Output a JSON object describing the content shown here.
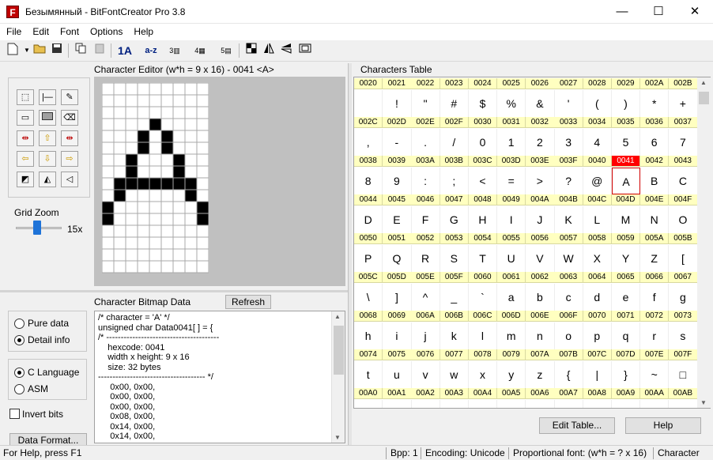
{
  "window": {
    "title": "Безымянный - BitFontCreator Pro 3.8",
    "app_icon_letter": "F",
    "minimize": "—",
    "maximize": "☐",
    "close": "✕"
  },
  "menu": [
    "File",
    "Edit",
    "Font",
    "Options",
    "Help"
  ],
  "toolbar": {
    "btn1": "1A",
    "btn2": "a-z",
    "btn3": "3",
    "btn4": "4",
    "btn5": "5"
  },
  "editor": {
    "header": "Character Editor (w*h = 9 x 16) - 0041 <A>",
    "grid_zoom_label": "Grid Zoom",
    "zoom_value": "15x",
    "bitmap_rows": [
      "000000000",
      "000000000",
      "000000000",
      "000010000",
      "000101000",
      "000101000",
      "001000100",
      "001000100",
      "011111110",
      "010000010",
      "100000001",
      "100000001",
      "000000000",
      "000000000",
      "000000000",
      "000000000"
    ]
  },
  "bitmap": {
    "header": "Character Bitmap Data",
    "refresh": "Refresh",
    "text": "/* character = 'A' */\nunsigned char Data0041[ ] = {\n/* ---------------------------------------\n    hexcode: 0041\n    width x height: 9 x 16\n    size: 32 bytes\n------------------------------------- */\n     0x00, 0x00,\n     0x00, 0x00,\n     0x00, 0x00,\n     0x08, 0x00,\n     0x14, 0x00,\n     0x14, 0x00,"
  },
  "options": {
    "pure_data": "Pure data",
    "detail_info": "Detail info",
    "c_language": "C Language",
    "asm": "ASM",
    "invert_bits": "Invert bits",
    "data_format": "Data Format..."
  },
  "chars_table": {
    "header": "Characters Table",
    "edit_table": "Edit Table...",
    "help": "Help",
    "rows": [
      {
        "codes": [
          "0020",
          "0021",
          "0022",
          "0023",
          "0024",
          "0025",
          "0026",
          "0027",
          "0028",
          "0029",
          "002A",
          "002B"
        ],
        "chars": [
          " ",
          "!",
          "\"",
          "#",
          "$",
          "%",
          "&",
          "'",
          "(",
          ")",
          "*",
          "+"
        ]
      },
      {
        "codes": [
          "002C",
          "002D",
          "002E",
          "002F",
          "0030",
          "0031",
          "0032",
          "0033",
          "0034",
          "0035",
          "0036",
          "0037"
        ],
        "chars": [
          ",",
          "-",
          ".",
          "/",
          "0",
          "1",
          "2",
          "3",
          "4",
          "5",
          "6",
          "7"
        ]
      },
      {
        "codes": [
          "0038",
          "0039",
          "003A",
          "003B",
          "003C",
          "003D",
          "003E",
          "003F",
          "0040",
          "0041",
          "0042",
          "0043"
        ],
        "chars": [
          "8",
          "9",
          ":",
          ";",
          "<",
          "=",
          ">",
          "?",
          "@",
          "A",
          "B",
          "C"
        ]
      },
      {
        "codes": [
          "0044",
          "0045",
          "0046",
          "0047",
          "0048",
          "0049",
          "004A",
          "004B",
          "004C",
          "004D",
          "004E",
          "004F"
        ],
        "chars": [
          "D",
          "E",
          "F",
          "G",
          "H",
          "I",
          "J",
          "K",
          "L",
          "M",
          "N",
          "O"
        ]
      },
      {
        "codes": [
          "0050",
          "0051",
          "0052",
          "0053",
          "0054",
          "0055",
          "0056",
          "0057",
          "0058",
          "0059",
          "005A",
          "005B"
        ],
        "chars": [
          "P",
          "Q",
          "R",
          "S",
          "T",
          "U",
          "V",
          "W",
          "X",
          "Y",
          "Z",
          "["
        ]
      },
      {
        "codes": [
          "005C",
          "005D",
          "005E",
          "005F",
          "0060",
          "0061",
          "0062",
          "0063",
          "0064",
          "0065",
          "0066",
          "0067"
        ],
        "chars": [
          "\\",
          "]",
          "^",
          "_",
          "`",
          "a",
          "b",
          "c",
          "d",
          "e",
          "f",
          "g"
        ]
      },
      {
        "codes": [
          "0068",
          "0069",
          "006A",
          "006B",
          "006C",
          "006D",
          "006E",
          "006F",
          "0070",
          "0071",
          "0072",
          "0073"
        ],
        "chars": [
          "h",
          "i",
          "j",
          "k",
          "l",
          "m",
          "n",
          "o",
          "p",
          "q",
          "r",
          "s"
        ]
      },
      {
        "codes": [
          "0074",
          "0075",
          "0076",
          "0077",
          "0078",
          "0079",
          "007A",
          "007B",
          "007C",
          "007D",
          "007E",
          "007F"
        ],
        "chars": [
          "t",
          "u",
          "v",
          "w",
          "x",
          "y",
          "z",
          "{",
          "|",
          "}",
          "~",
          "□"
        ]
      },
      {
        "codes": [
          "00A0",
          "00A1",
          "00A2",
          "00A3",
          "00A4",
          "00A5",
          "00A6",
          "00A7",
          "00A8",
          "00A9",
          "00AA",
          "00AB"
        ],
        "chars": [
          "",
          "",
          "",
          "",
          "",
          "",
          "",
          "",
          "",
          "",
          "",
          ""
        ]
      }
    ],
    "selected": "0041"
  },
  "status": {
    "help": "For Help, press F1",
    "bpp": "Bpp: 1",
    "encoding": "Encoding: Unicode",
    "font": "Proportional font: (w*h = ? x 16)",
    "mode": "Character"
  }
}
